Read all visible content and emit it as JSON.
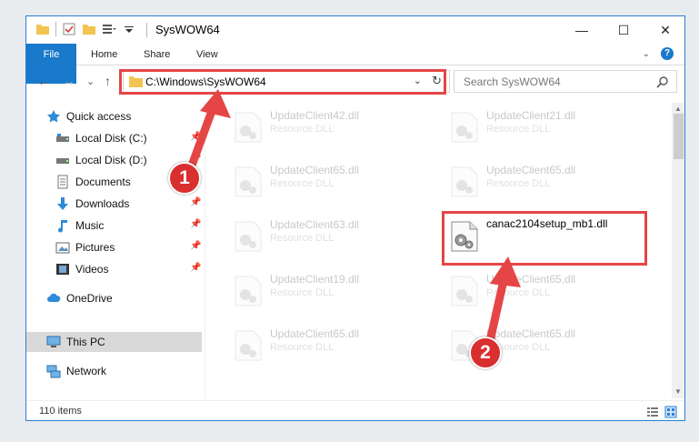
{
  "window": {
    "title": "SysWOW64",
    "controls": {
      "minimize": "—",
      "maximize": "☐",
      "close": "✕"
    }
  },
  "ribbon": {
    "tabs": [
      "File",
      "Home",
      "Share",
      "View"
    ],
    "toggle": "⌄",
    "help": "?"
  },
  "nav": {
    "back": "←",
    "forward": "→",
    "recent": "⌄",
    "up": "↑"
  },
  "address": {
    "path": "C:\\Windows\\SysWOW64",
    "dropdown": "⌄",
    "refresh": "↻"
  },
  "search": {
    "placeholder": "Search SysWOW64"
  },
  "sidebar": {
    "items": [
      {
        "label": "Quick access",
        "icon": "star-icon",
        "pinned": false
      },
      {
        "label": "Local Disk (C:)",
        "icon": "drive-icon",
        "pinned": true
      },
      {
        "label": "Local Disk (D:)",
        "icon": "drive-icon",
        "pinned": true
      },
      {
        "label": "Documents",
        "icon": "documents-icon",
        "pinned": true
      },
      {
        "label": "Downloads",
        "icon": "download-icon",
        "pinned": true
      },
      {
        "label": "Music",
        "icon": "music-icon",
        "pinned": true
      },
      {
        "label": "Pictures",
        "icon": "pictures-icon",
        "pinned": true
      },
      {
        "label": "Videos",
        "icon": "videos-icon",
        "pinned": true
      },
      {
        "label": "OneDrive",
        "icon": "cloud-icon",
        "pinned": false
      },
      {
        "label": "This PC",
        "icon": "computer-icon",
        "pinned": false,
        "selected": true
      },
      {
        "label": "Network",
        "icon": "network-icon",
        "pinned": false
      }
    ],
    "pin_glyph": "📌"
  },
  "files": [
    {
      "name": "UpdateClient42.dll",
      "type": "Resource DLL",
      "faded": true
    },
    {
      "name": "UpdateClient21.dll",
      "type": "Resource DLL",
      "faded": true
    },
    {
      "name": "UpdateClient65.dll",
      "type": "Resource DLL",
      "faded": true
    },
    {
      "name": "UpdateClient65.dll",
      "type": "Resource DLL",
      "faded": true
    },
    {
      "name": "UpdateClient63.dll",
      "type": "Resource DLL",
      "faded": true
    },
    {
      "name": "canac2104setup_mb1.dll",
      "type": "",
      "faded": false
    },
    {
      "name": "UpdateClient19.dll",
      "type": "Resource DLL",
      "faded": true
    },
    {
      "name": "UpdateClient65.dll",
      "type": "Resource DLL",
      "faded": true
    },
    {
      "name": "UpdateClient65.dll",
      "type": "Resource DLL",
      "faded": true
    },
    {
      "name": "UpdateClient65.dll",
      "type": "Resource DLL",
      "faded": true
    }
  ],
  "status": {
    "items_count": "110 items"
  },
  "annotations": {
    "callout_1": "1",
    "callout_2": "2",
    "color": "#e54545"
  }
}
